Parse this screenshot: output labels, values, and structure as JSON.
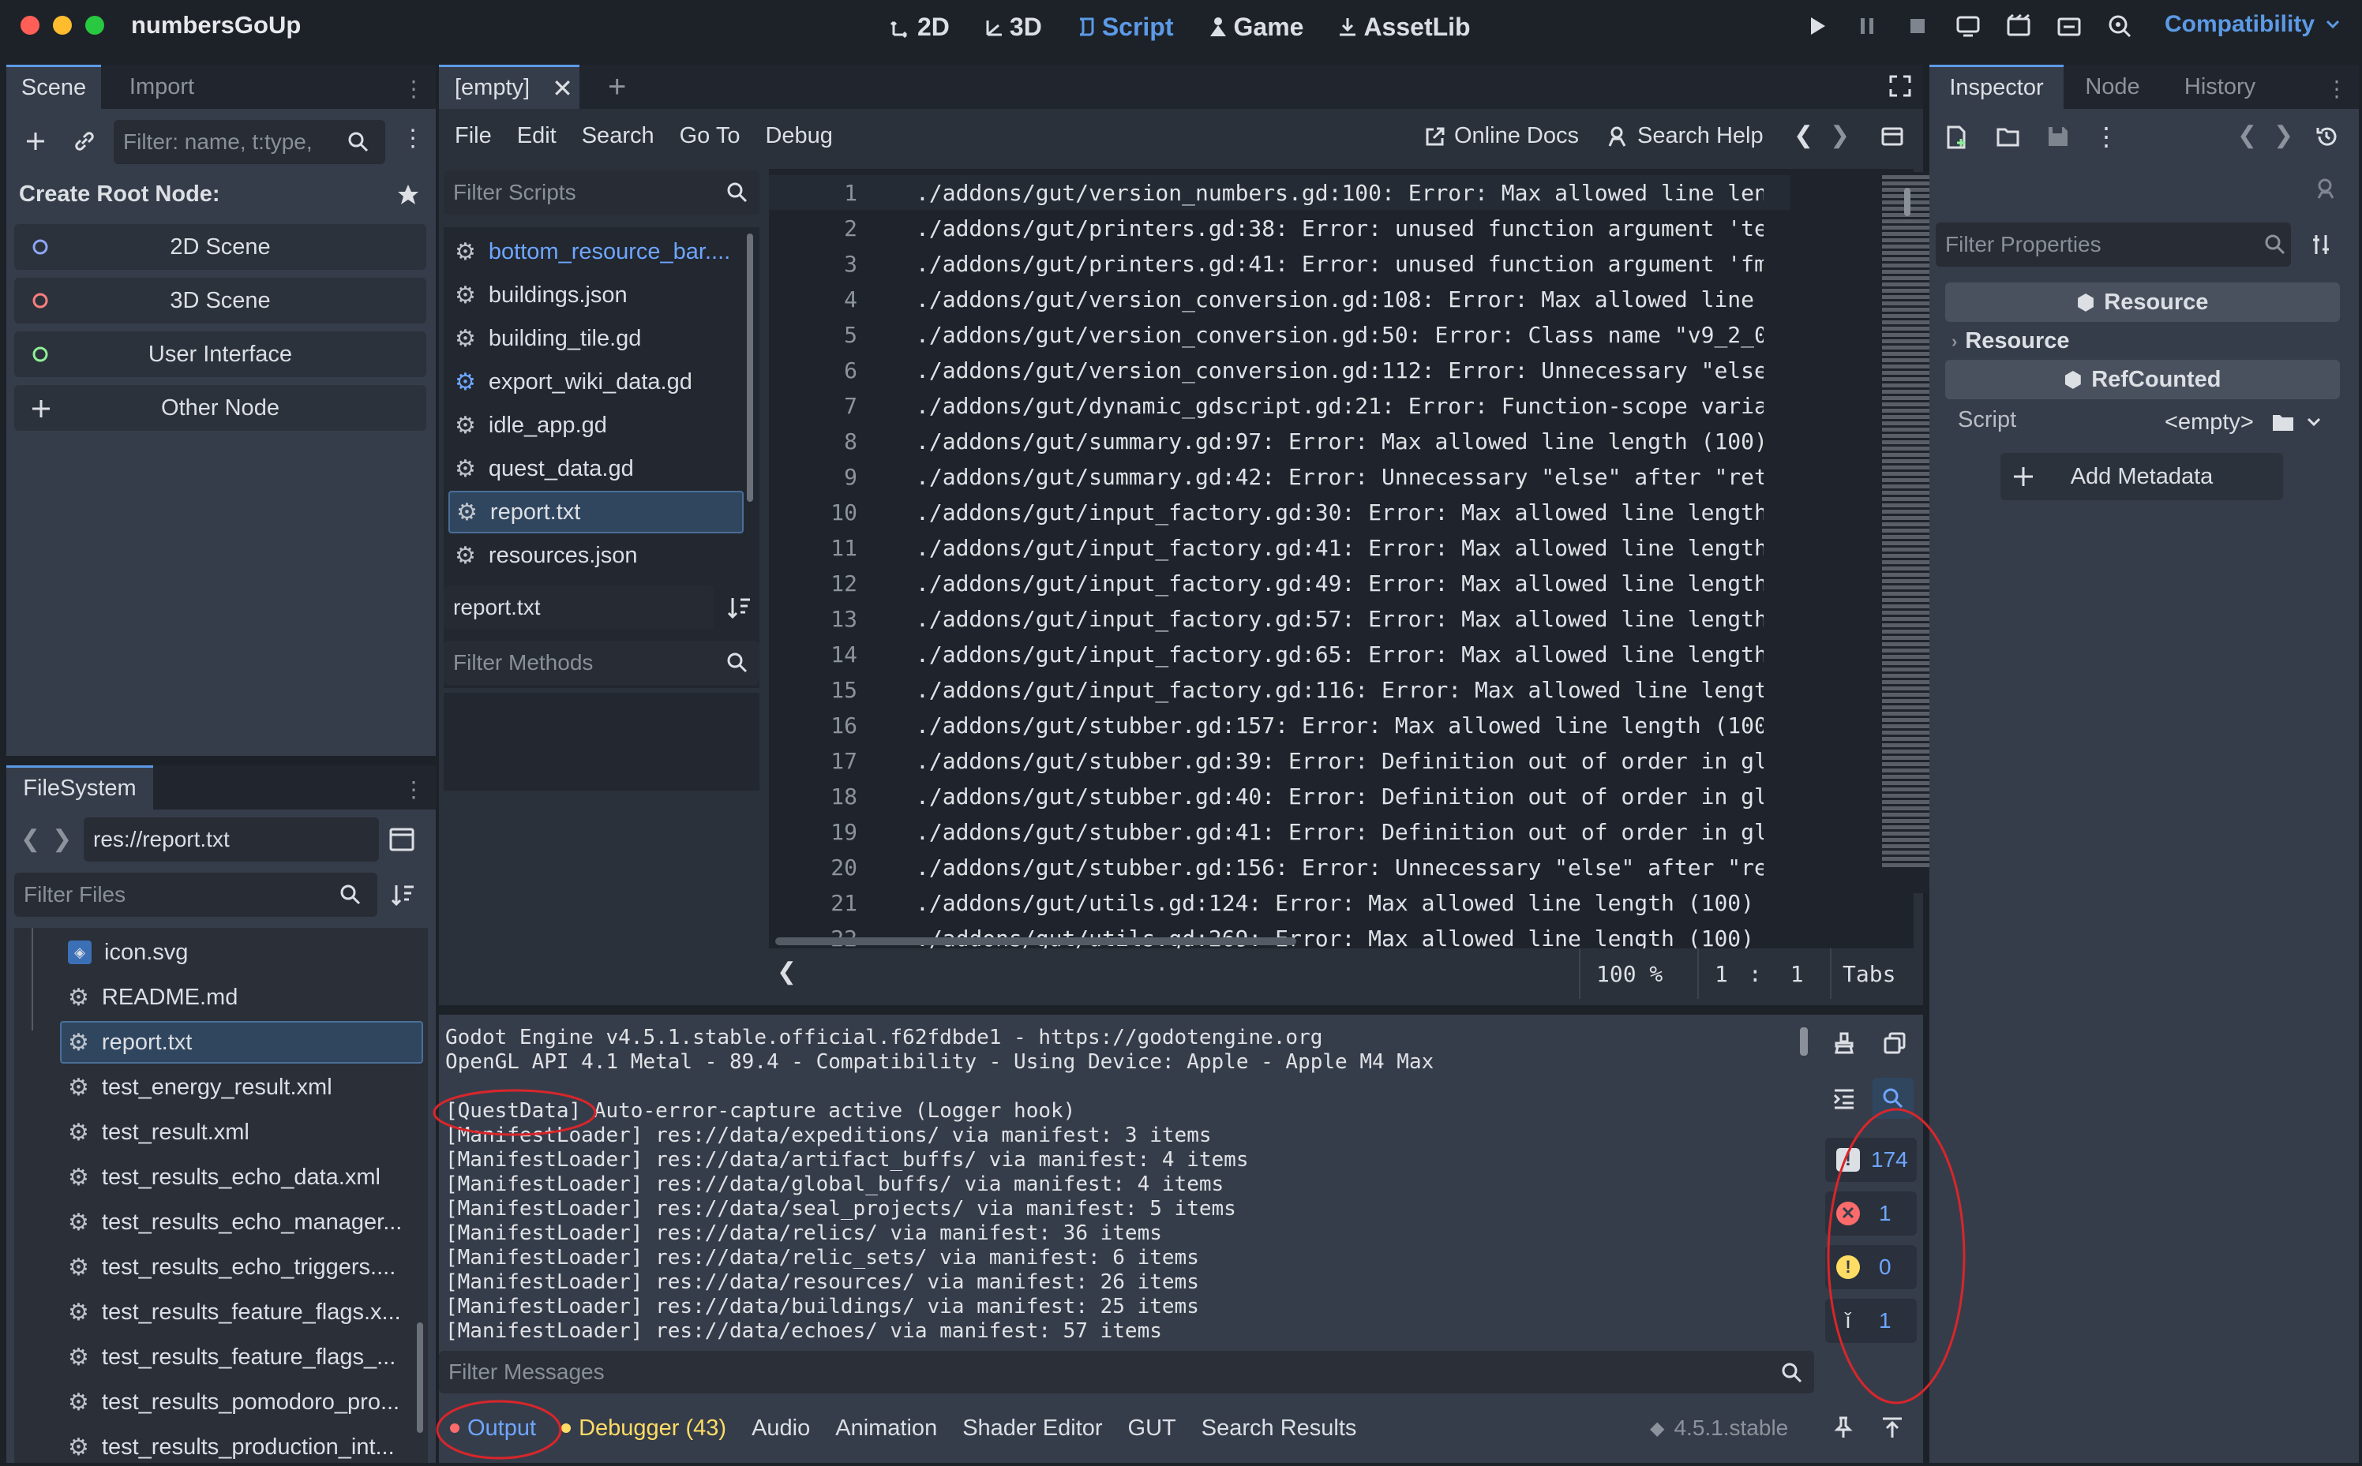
{
  "app": {
    "title": "numbersGoUp",
    "workspaces": [
      {
        "label": "2D",
        "icon": "2d-icon"
      },
      {
        "label": "3D",
        "icon": "3d-icon"
      },
      {
        "label": "Script",
        "icon": "script-icon",
        "active": true
      },
      {
        "label": "Game",
        "icon": "game-icon"
      },
      {
        "label": "AssetLib",
        "icon": "assetlib-icon"
      }
    ],
    "renderer": "Compatibility",
    "accent": "#5c9ae6"
  },
  "scene_panel": {
    "tabs": [
      "Scene",
      "Import"
    ],
    "filter_placeholder": "Filter: name, t:type,",
    "create_root_label": "Create Root Node:",
    "root_options": [
      {
        "label": "2D Scene",
        "color": "#8da5f3"
      },
      {
        "label": "3D Scene",
        "color": "#fc7f7f"
      },
      {
        "label": "User Interface",
        "color": "#8eef97"
      },
      {
        "label": "Other Node",
        "color": "#dcdfe4"
      }
    ]
  },
  "filesystem": {
    "tab": "FileSystem",
    "path": "res://report.txt",
    "filter_placeholder": "Filter Files",
    "files": [
      "icon.svg",
      "README.md",
      "report.txt",
      "test_energy_result.xml",
      "test_result.xml",
      "test_results_echo_data.xml",
      "test_results_echo_manager...",
      "test_results_echo_triggers....",
      "test_results_feature_flags.x...",
      "test_results_feature_flags_...",
      "test_results_pomodoro_pro...",
      "test_results_production_int..."
    ],
    "selected": "report.txt"
  },
  "script_editor": {
    "tab_label": "[empty]",
    "menu": [
      "File",
      "Edit",
      "Search",
      "Go To",
      "Debug"
    ],
    "online_docs": "Online Docs",
    "search_help": "Search Help",
    "filter_scripts_placeholder": "Filter Scripts",
    "scripts": [
      "bottom_resource_bar....",
      "buildings.json",
      "building_tile.gd",
      "export_wiki_data.gd",
      "idle_app.gd",
      "quest_data.gd",
      "report.txt",
      "resources.json"
    ],
    "selected_script": "report.txt",
    "current_file": "report.txt",
    "filter_methods_placeholder": "Filter Methods",
    "lines": [
      {
        "n": "1",
        "text": "./addons/gut/version_numbers.gd:100: Error: Max allowed line len"
      },
      {
        "n": "2",
        "text": "./addons/gut/printers.gd:38: Error: unused function argument 'te"
      },
      {
        "n": "3",
        "text": "./addons/gut/printers.gd:41: Error: unused function argument 'fm"
      },
      {
        "n": "4",
        "text": "./addons/gut/version_conversion.gd:108: Error: Max allowed line "
      },
      {
        "n": "5",
        "text": "./addons/gut/version_conversion.gd:50: Error: Class name \"v9_2_0"
      },
      {
        "n": "6",
        "text": "./addons/gut/version_conversion.gd:112: Error: Unnecessary \"else"
      },
      {
        "n": "7",
        "text": "./addons/gut/dynamic_gdscript.gd:21: Error: Function-scope varia"
      },
      {
        "n": "8",
        "text": "./addons/gut/summary.gd:97: Error: Max allowed line length (100)"
      },
      {
        "n": "9",
        "text": "./addons/gut/summary.gd:42: Error: Unnecessary \"else\" after \"ret"
      },
      {
        "n": "10",
        "text": "./addons/gut/input_factory.gd:30: Error: Max allowed line length"
      },
      {
        "n": "11",
        "text": "./addons/gut/input_factory.gd:41: Error: Max allowed line length"
      },
      {
        "n": "12",
        "text": "./addons/gut/input_factory.gd:49: Error: Max allowed line length"
      },
      {
        "n": "13",
        "text": "./addons/gut/input_factory.gd:57: Error: Max allowed line length"
      },
      {
        "n": "14",
        "text": "./addons/gut/input_factory.gd:65: Error: Max allowed line length"
      },
      {
        "n": "15",
        "text": "./addons/gut/input_factory.gd:116: Error: Max allowed line lengt"
      },
      {
        "n": "16",
        "text": "./addons/gut/stubber.gd:157: Error: Max allowed line length (100"
      },
      {
        "n": "17",
        "text": "./addons/gut/stubber.gd:39: Error: Definition out of order in gl"
      },
      {
        "n": "18",
        "text": "./addons/gut/stubber.gd:40: Error: Definition out of order in gl"
      },
      {
        "n": "19",
        "text": "./addons/gut/stubber.gd:41: Error: Definition out of order in gl"
      },
      {
        "n": "20",
        "text": "./addons/gut/stubber.gd:156: Error: Unnecessary \"else\" after \"re"
      },
      {
        "n": "21",
        "text": "./addons/gut/utils.gd:124: Error: Max allowed line length (100)"
      },
      {
        "n": "22",
        "text": "./addons/gut/utils.gd:269: Error: Max allowed line length (100)"
      }
    ],
    "status": {
      "zoom": "100 %",
      "line": "1",
      "col": "1",
      "indent": "Tabs"
    }
  },
  "output": {
    "lines": [
      "Godot Engine v4.5.1.stable.official.f62fdbde1 - https://godotengine.org",
      "OpenGL API 4.1 Metal - 89.4 - Compatibility - Using Device: Apple - Apple M4 Max",
      "",
      "[QuestData] Auto-error-capture active (Logger hook)",
      "[ManifestLoader] res://data/expeditions/ via manifest: 3 items",
      "[ManifestLoader] res://data/artifact_buffs/ via manifest: 4 items",
      "[ManifestLoader] res://data/global_buffs/ via manifest: 4 items",
      "[ManifestLoader] res://data/seal_projects/ via manifest: 5 items",
      "[ManifestLoader] res://data/relics/ via manifest: 36 items",
      "[ManifestLoader] res://data/relic_sets/ via manifest: 6 items",
      "[ManifestLoader] res://data/resources/ via manifest: 26 items",
      "[ManifestLoader] res://data/buildings/ via manifest: 25 items",
      "[ManifestLoader] res://data/echoes/ via manifest: 57 items"
    ],
    "filter_placeholder": "Filter Messages",
    "counters": {
      "messages": "174",
      "errors": "1",
      "warnings": "0",
      "editor": "1"
    }
  },
  "bottom_panel": {
    "tabs": [
      "Output",
      "Debugger (43)",
      "Audio",
      "Animation",
      "Shader Editor",
      "GUT",
      "Search Results"
    ],
    "version": "4.5.1.stable"
  },
  "inspector": {
    "tabs": [
      "Inspector",
      "Node",
      "History"
    ],
    "filter_placeholder": "Filter Properties",
    "resource_header": "Resource",
    "resource_group": "Resource",
    "refcounted_header": "RefCounted",
    "script_label": "Script",
    "script_value": "<empty>",
    "add_metadata": "Add Metadata"
  },
  "annotation_color": "#d8262b"
}
